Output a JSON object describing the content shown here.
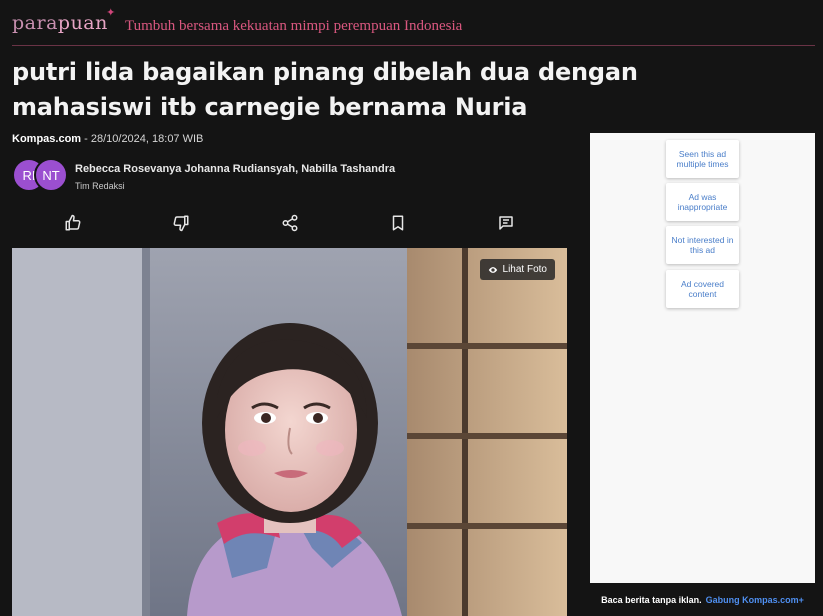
{
  "site": {
    "logo_part1": "para",
    "logo_part2": "puan",
    "logo_star": "✦",
    "tagline": "Tumbuh bersama kekuatan mimpi perempuan Indonesia"
  },
  "article": {
    "title": "putri lida bagaikan pinang dibelah dua dengan mahasiswi itb carnegie bernama Nuria",
    "source": "Kompas.com",
    "date": "- 28/10/2024, 18:07 WIB",
    "authors": "Rebecca Rosevanya Johanna Rudiansyah, Nabilla Tashandra",
    "role": "Tim Redaksi",
    "avatar1_initials": "RI",
    "avatar2_initials": "NT",
    "photo_button": "Lihat Foto"
  },
  "actions": [
    "thumbs-up-icon",
    "thumbs-down-icon",
    "share-icon",
    "bookmark-icon",
    "comment-icon"
  ],
  "ad": {
    "options": [
      "Seen this ad multiple times",
      "Ad was inappropriate",
      "Not interested in this ad",
      "Ad covered content"
    ],
    "footer_text": "Baca berita tanpa iklan.",
    "footer_link": "Gabung Kompas.com+"
  },
  "colors": {
    "background": "#141414",
    "accent": "#d9577f",
    "avatar": "#9b4fd0",
    "ad_link": "#4a7ec9"
  }
}
